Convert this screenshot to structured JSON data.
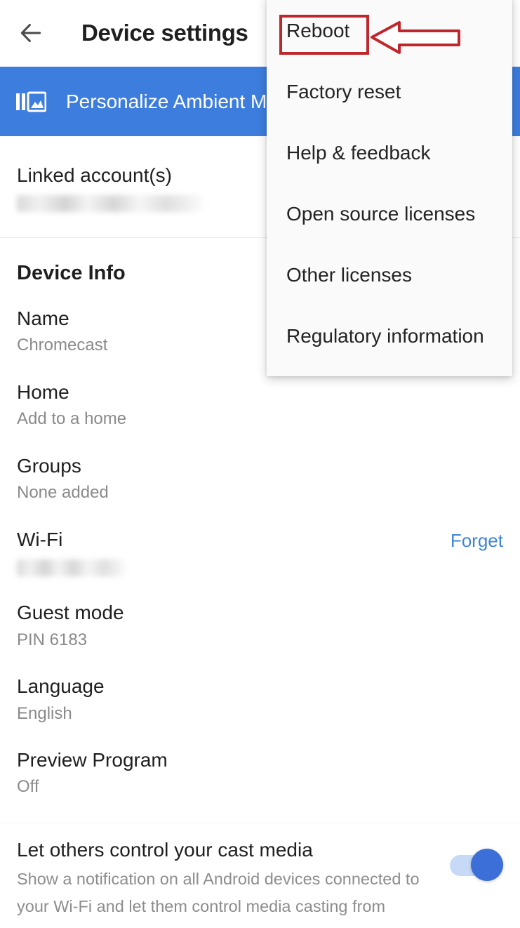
{
  "appbar": {
    "back_icon": "arrow-left-icon",
    "title": "Device settings"
  },
  "banner": {
    "icon": "ambient-photo-icon",
    "label": "Personalize Ambient Mode",
    "background_color": "#3d7ddd"
  },
  "overflow_menu": {
    "items": [
      {
        "label": "Reboot"
      },
      {
        "label": "Factory reset"
      },
      {
        "label": "Help & feedback"
      },
      {
        "label": "Open source licenses"
      },
      {
        "label": "Other licenses"
      },
      {
        "label": "Regulatory information"
      }
    ]
  },
  "annotation": {
    "highlight_color": "#c0272d",
    "target_label": "Reboot",
    "arrow_icon": "arrow-left-annotation-icon"
  },
  "linked_accounts": {
    "title": "Linked account(s)",
    "value": ""
  },
  "device_info": {
    "heading": "Device Info",
    "rows": [
      {
        "title": "Name",
        "sub": "Chromecast"
      },
      {
        "title": "Home",
        "sub": "Add to a home"
      },
      {
        "title": "Groups",
        "sub": "None added"
      }
    ],
    "wifi": {
      "title": "Wi-Fi",
      "value": "",
      "action_label": "Forget",
      "action_color": "#4285d6"
    },
    "guest_mode": {
      "title": "Guest mode",
      "sub": "PIN 6183"
    },
    "language": {
      "title": "Language",
      "sub": "English"
    },
    "preview_program": {
      "title": "Preview Program",
      "sub": "Off"
    }
  },
  "cast_media": {
    "title": "Let others control your cast media",
    "description": "Show a notification on all Android devices connected to your Wi-Fi and let them control media casting from",
    "toggle_state": "on",
    "toggle_on_color": "#3d6fd8"
  }
}
